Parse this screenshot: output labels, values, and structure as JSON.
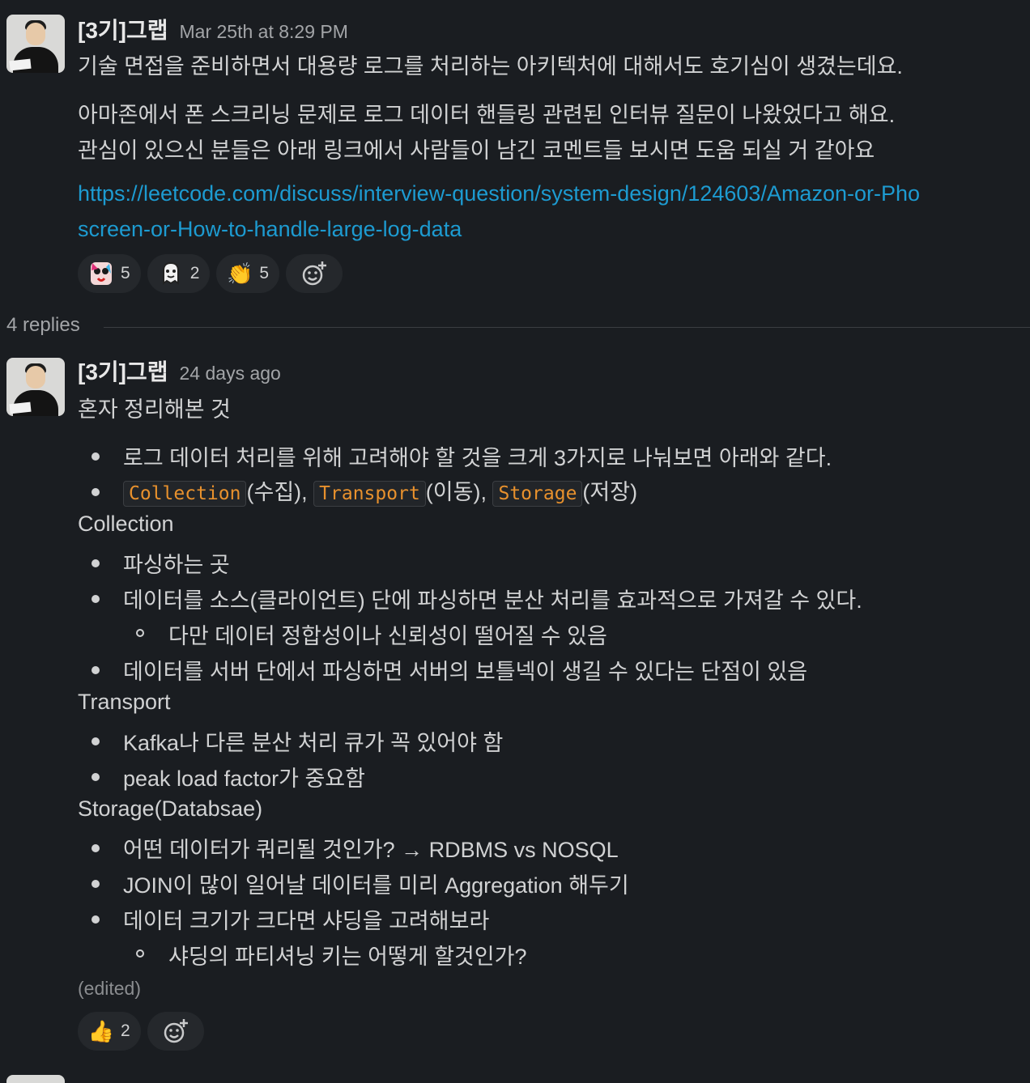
{
  "parent": {
    "author": "[3기]그랩",
    "time": "Mar 25th at 8:29 PM",
    "line1": "기술 면접을 준비하면서 대용량 로그를 처리하는 아키텍처에 대해서도 호기심이 생겼는데요.",
    "line2": "아마존에서 폰 스크리닝 문제로 로그 데이터 핸들링 관련된 인터뷰 질문이 나왔었다고 해요.",
    "line3": "관심이 있으신 분들은 아래 링크에서 사람들이 남긴 코멘트들 보시면 도움 되실 거 같아요",
    "link_line1": "https://leetcode.com/discuss/interview-question/system-design/124603/Amazon-or-Pho",
    "link_line2": "screen-or-How-to-handle-large-log-data",
    "reactions": [
      {
        "icon": "anime-face-emoji",
        "count": "5"
      },
      {
        "icon": "ghost-emoji",
        "count": "2"
      },
      {
        "icon": "clap-emoji",
        "count": "5"
      }
    ]
  },
  "replies_label": "4 replies",
  "reply": {
    "author": "[3기]그랩",
    "time": "24 days ago",
    "intro": "혼자 정리해본 것",
    "b1": "로그 데이터 처리를 위해 고려해야 할 것을 크게 3가지로 나눠보면 아래와 같다.",
    "code1": "Collection",
    "code1_suffix": "(수집),",
    "code2": "Transport",
    "code2_suffix": "(이동),",
    "code3": "Storage",
    "code3_suffix": "(저장)",
    "h_collection": "Collection",
    "c1": "파싱하는 곳",
    "c2": "데이터를 소스(클라이언트) 단에 파싱하면 분산 처리를 효과적으로 가져갈 수 있다.",
    "c2_sub": "다만 데이터 정합성이나 신뢰성이 떨어질 수 있음",
    "c3": "데이터를 서버 단에서 파싱하면 서버의 보틀넥이 생길 수 있다는 단점이 있음",
    "h_transport": "Transport",
    "t1": "Kafka나 다른 분산 처리 큐가 꼭 있어야 함",
    "t2": "peak load factor가 중요함",
    "h_storage": "Storage(Databsae)",
    "s1": "어떤 데이터가 쿼리될 것인가? → RDBMS vs NOSQL",
    "s2": "JOIN이 많이 일어날 데이터를 미리 Aggregation 해두기",
    "s3": "데이터 크기가 크다면 샤딩을 고려해보라",
    "s3_sub": "샤딩의 파티셔닝 키는 어떻게 할것인가?",
    "edited": "(edited)",
    "reactions": [
      {
        "icon": "thumbs-up-emoji",
        "count": "2"
      }
    ]
  }
}
